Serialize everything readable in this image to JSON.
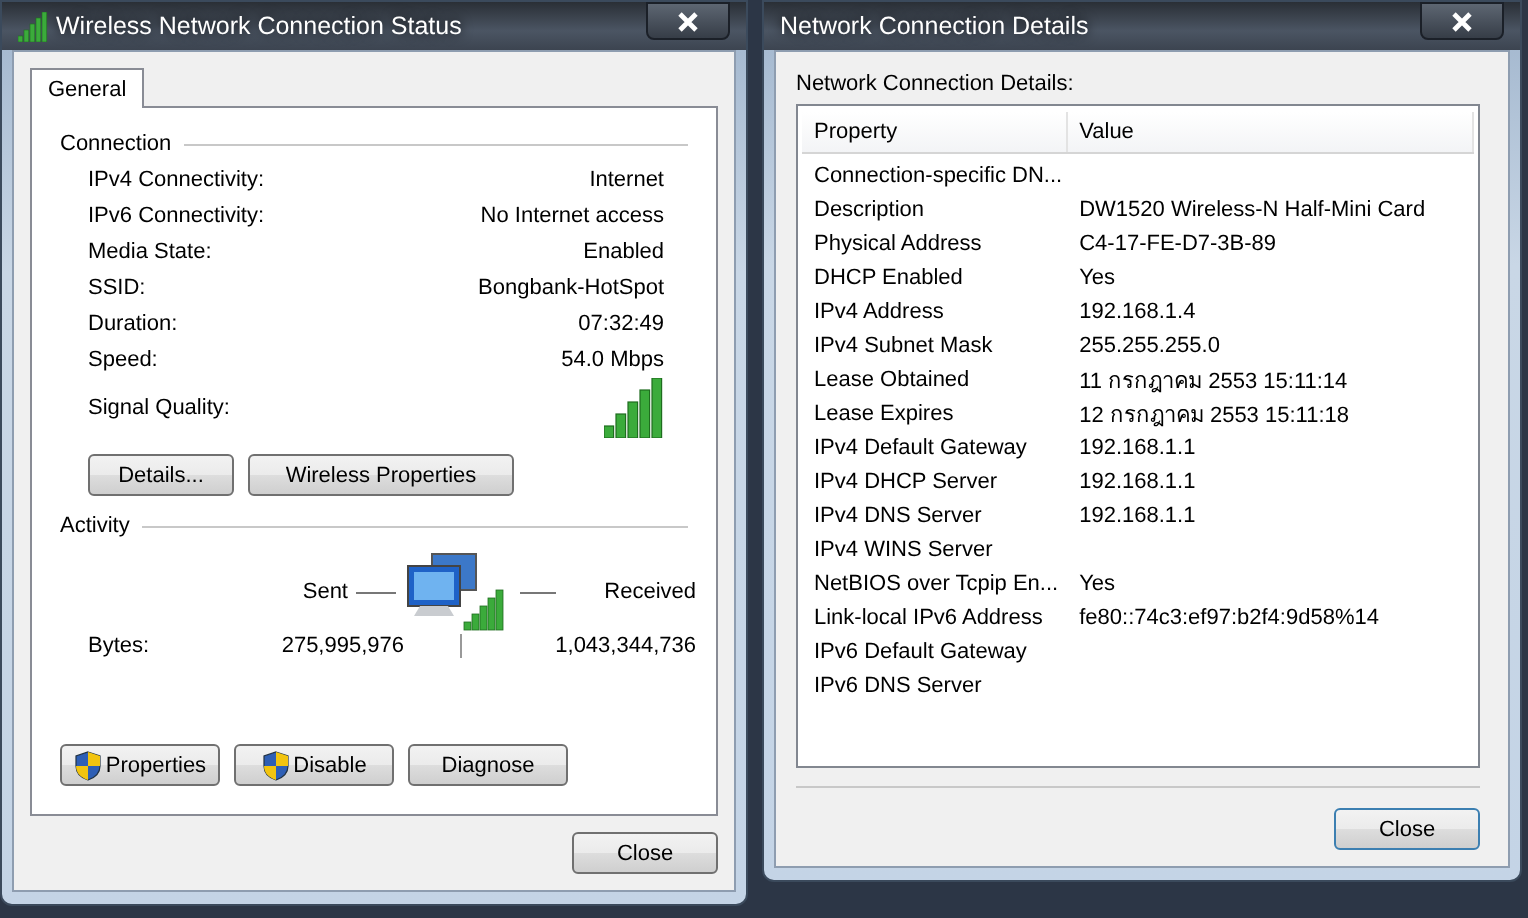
{
  "status_window": {
    "title": "Wireless Network Connection Status",
    "tabs": [
      {
        "label": "General",
        "selected": true
      }
    ],
    "connection": {
      "heading": "Connection",
      "rows": [
        {
          "label": "IPv4 Connectivity:",
          "value": "Internet"
        },
        {
          "label": "IPv6 Connectivity:",
          "value": "No Internet access"
        },
        {
          "label": "Media State:",
          "value": "Enabled"
        },
        {
          "label": "SSID:",
          "value": "Bongbank-HotSpot"
        },
        {
          "label": "Duration:",
          "value": "07:32:49"
        },
        {
          "label": "Speed:",
          "value": "54.0 Mbps"
        }
      ],
      "signal_label": "Signal Quality:"
    },
    "link_buttons": [
      "Details...",
      "Wireless Properties"
    ],
    "activity": {
      "heading": "Activity",
      "sent": "Sent",
      "received": "Received",
      "bytes_label": "Bytes:",
      "sent_bytes": "275,995,976",
      "received_bytes": "1,043,344,736"
    },
    "action_buttons": [
      {
        "label": "Properties",
        "kind": "shield"
      },
      {
        "label": "Disable",
        "kind": "shield"
      },
      {
        "label": "Diagnose",
        "kind": "plain"
      }
    ],
    "close": "Close"
  },
  "details_window": {
    "title": "Network Connection Details",
    "caption": "Network Connection Details:",
    "columns": [
      "Property",
      "Value"
    ],
    "rows": [
      {
        "property": "Connection-specific DN...",
        "value": ""
      },
      {
        "property": "Description",
        "value": "DW1520 Wireless-N Half-Mini Card"
      },
      {
        "property": "Physical Address",
        "value": "C4-17-FE-D7-3B-89"
      },
      {
        "property": "DHCP Enabled",
        "value": "Yes"
      },
      {
        "property": "IPv4 Address",
        "value": "192.168.1.4"
      },
      {
        "property": "IPv4 Subnet Mask",
        "value": "255.255.255.0"
      },
      {
        "property": "Lease Obtained",
        "value": "11 กรกฎาคม 2553 15:11:14"
      },
      {
        "property": "Lease Expires",
        "value": "12 กรกฎาคม 2553 15:11:18"
      },
      {
        "property": "IPv4 Default Gateway",
        "value": "192.168.1.1"
      },
      {
        "property": "IPv4 DHCP Server",
        "value": "192.168.1.1"
      },
      {
        "property": "IPv4 DNS Server",
        "value": "192.168.1.1"
      },
      {
        "property": "IPv4 WINS Server",
        "value": ""
      },
      {
        "property": "NetBIOS over Tcpip En...",
        "value": "Yes"
      },
      {
        "property": "Link-local IPv6 Address",
        "value": "fe80::74c3:ef97:b2f4:9d58%14"
      },
      {
        "property": "IPv6 Default Gateway",
        "value": ""
      },
      {
        "property": "IPv6 DNS Server",
        "value": ""
      }
    ],
    "close": "Close"
  }
}
